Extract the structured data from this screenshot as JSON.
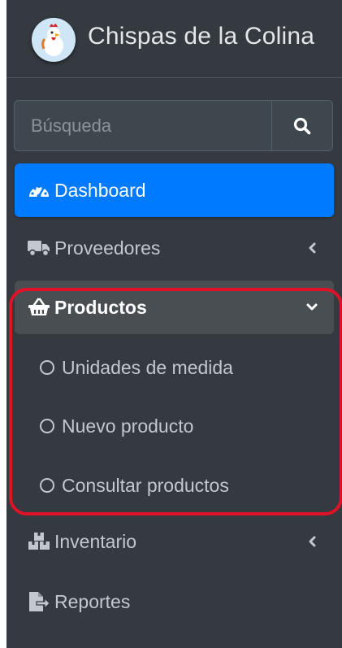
{
  "brand": {
    "title": "Chispas de la Colina",
    "logo_icon": "rooster-logo-icon"
  },
  "search": {
    "placeholder": "Búsqueda",
    "value": "",
    "button_icon": "search-icon"
  },
  "nav": {
    "dashboard": {
      "label": "Dashboard",
      "icon": "tachometer-icon",
      "active": true
    },
    "proveedores": {
      "label": "Proveedores",
      "icon": "truck-icon",
      "chevron": "chevron-left-icon"
    },
    "productos": {
      "label": "Productos",
      "icon": "shopping-basket-icon",
      "chevron": "chevron-down-icon",
      "open": true,
      "children": [
        {
          "label": "Unidades de medida",
          "icon": "circle-icon"
        },
        {
          "label": "Nuevo producto",
          "icon": "circle-icon"
        },
        {
          "label": "Consultar productos",
          "icon": "circle-icon"
        }
      ]
    },
    "inventario": {
      "label": "Inventario",
      "icon": "boxes-icon",
      "chevron": "chevron-left-icon"
    },
    "reportes": {
      "label": "Reportes",
      "icon": "file-export-icon"
    }
  },
  "colors": {
    "sidebar_bg": "#343a40",
    "active_bg": "#007bff",
    "open_bg": "#494e53",
    "text": "#c2c7d0",
    "highlight": "#e01228"
  }
}
